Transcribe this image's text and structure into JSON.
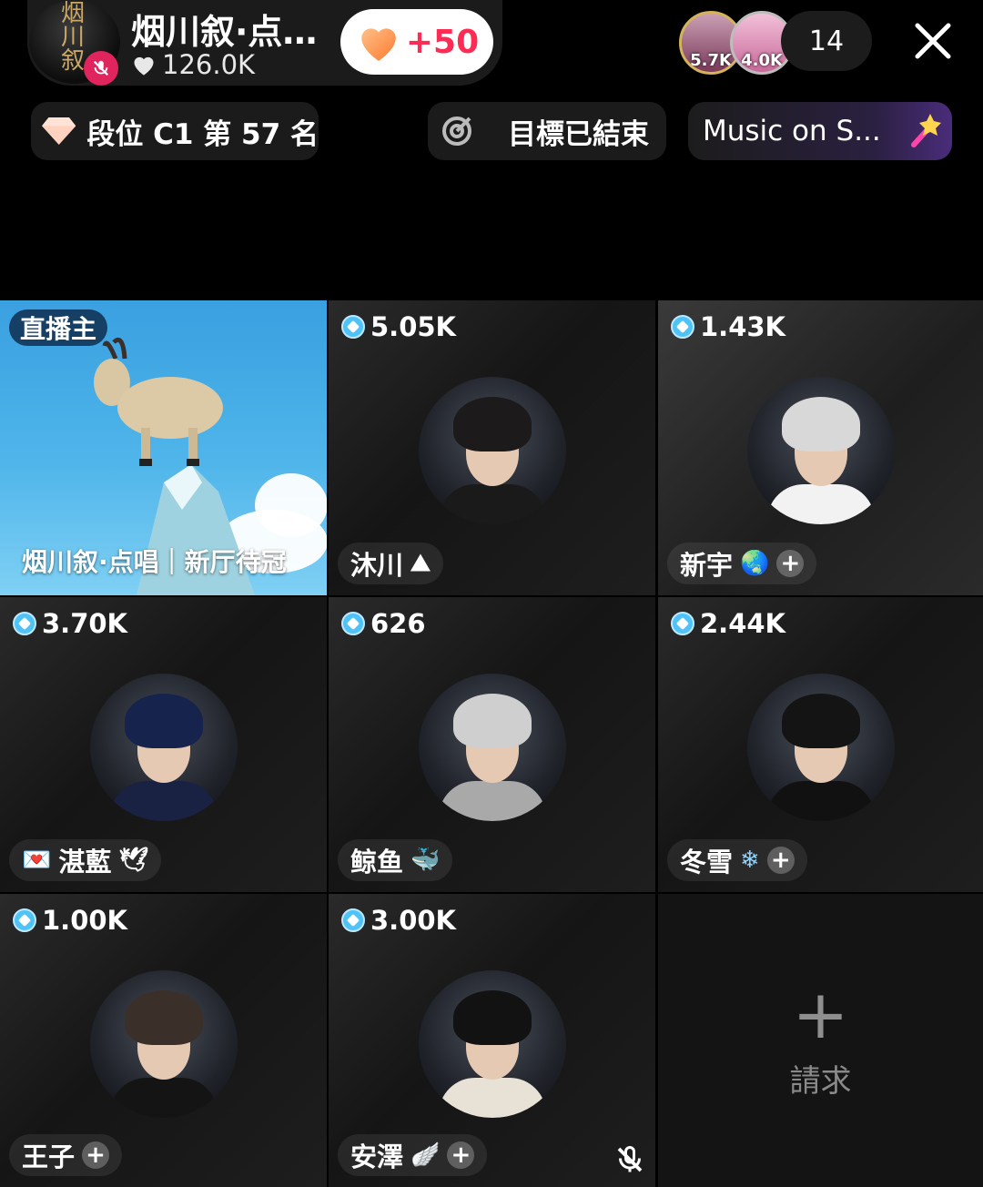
{
  "host": {
    "name": "烟川叙·点…",
    "likes": "126.0K",
    "like_bonus": "+50",
    "avatar_calligraphy": "烟川叙"
  },
  "top_viewers": [
    {
      "score": "5.7K",
      "color": "#b8607a"
    },
    {
      "score": "4.0K",
      "color": "#c86a9a"
    }
  ],
  "viewer_count": "14",
  "chips": {
    "rank": "段位 C1 第 57 名",
    "goal": "目標已結束",
    "music": "Music on S..."
  },
  "grid": [
    {
      "role": "host",
      "tag": "直播主",
      "caption": "烟川叙·点唱｜新厅待冠"
    },
    {
      "score": "5.05K",
      "name": "沐川",
      "emoji": "⛰",
      "follow": false,
      "hair": "#1c1a1a",
      "clothes": "#1a1a1a"
    },
    {
      "score": "1.43K",
      "name": "新宇",
      "emoji": "🌏",
      "follow": true,
      "hair": "#d8d8d8",
      "clothes": "#f2f2f2"
    },
    {
      "score": "3.70K",
      "name": "湛藍",
      "emoji_left": "💌",
      "emoji": "🕊",
      "follow": false,
      "hair": "#16234d",
      "clothes": "#1a2244"
    },
    {
      "score": "626",
      "name": "鲸鱼",
      "emoji": "🐳",
      "follow": false,
      "hair": "#cfcfcf",
      "clothes": "#a9a9a9"
    },
    {
      "score": "2.44K",
      "name": "冬雪",
      "emoji": "❄",
      "follow": true,
      "hair": "#141414",
      "clothes": "#111"
    },
    {
      "score": "1.00K",
      "name": "王子",
      "emoji": "",
      "follow": true,
      "hair": "#3b3029",
      "clothes": "#141414"
    },
    {
      "score": "3.00K",
      "name": "安澤",
      "emoji": "🪽",
      "follow": true,
      "muted": true,
      "hair": "#121212",
      "clothes": "#e8e2d6"
    },
    {
      "role": "request",
      "label": "請求",
      "plus": "+"
    }
  ],
  "colors": {
    "accent_pink": "#fe2c55",
    "heart_orange": "#ff9a4d",
    "gem_blue": "#4fc3f7"
  }
}
